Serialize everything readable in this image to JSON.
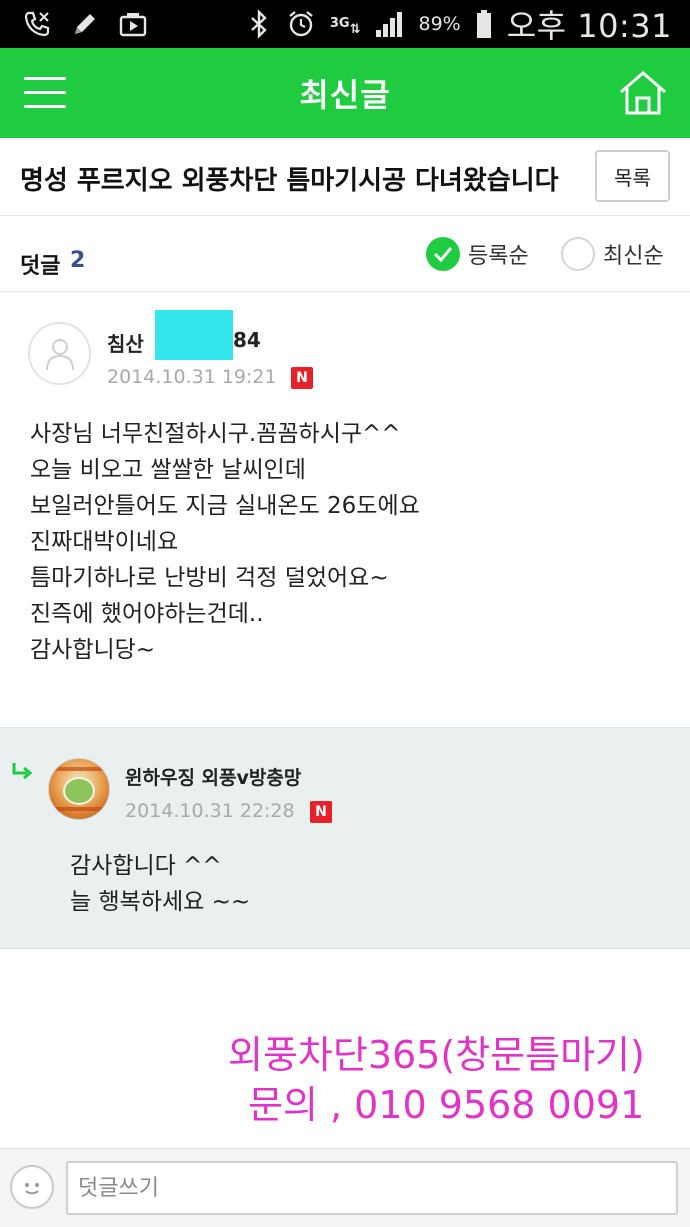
{
  "status_bar": {
    "network": "3G",
    "battery": "89%",
    "time": "오후 10:31"
  },
  "header": {
    "title": "최신글",
    "menu_icon": "hamburger-menu-icon",
    "home_icon": "home-icon"
  },
  "post": {
    "title": "명성 푸르지오 외풍차단 틈마기시공 다녀왔습니다",
    "list_button": "목록"
  },
  "comments_header": {
    "label": "덧글",
    "count": "2",
    "sort_options": [
      {
        "label": "등록순",
        "checked": true
      },
      {
        "label": "최신순",
        "checked": false
      }
    ]
  },
  "comment": {
    "author_prefix": "침산",
    "author_suffix": "84",
    "date": "2014.10.31 19:21",
    "badge": "N",
    "lines": [
      "사장님 너무친절하시구.꼼꼼하시구^^",
      "오늘 비오고 쌀쌀한 날씨인데",
      "보일러안틀어도 지금 실내온도 26도에요",
      "진짜대박이네요",
      "틈마기하나로 난방비 걱정 덜었어요~",
      "진즉에 했어야하는건데..",
      "감사합니당~"
    ]
  },
  "reply": {
    "author": "윈하우징 외풍v방충망",
    "date": "2014.10.31 22:28",
    "badge": "N",
    "lines": [
      "감사합니다 ^^",
      "늘 행복하세요 ~~"
    ]
  },
  "watermark": {
    "line1": "외풍차단365(창문틈마기)",
    "line2": "문의 , 010 9568 0091"
  },
  "input_bar": {
    "placeholder": "덧글쓰기"
  },
  "colors": {
    "brand_green": "#1fcc3f",
    "badge_red": "#e7212a",
    "count_blue": "#3a4f8c",
    "watermark_pink": "#e233c8"
  }
}
